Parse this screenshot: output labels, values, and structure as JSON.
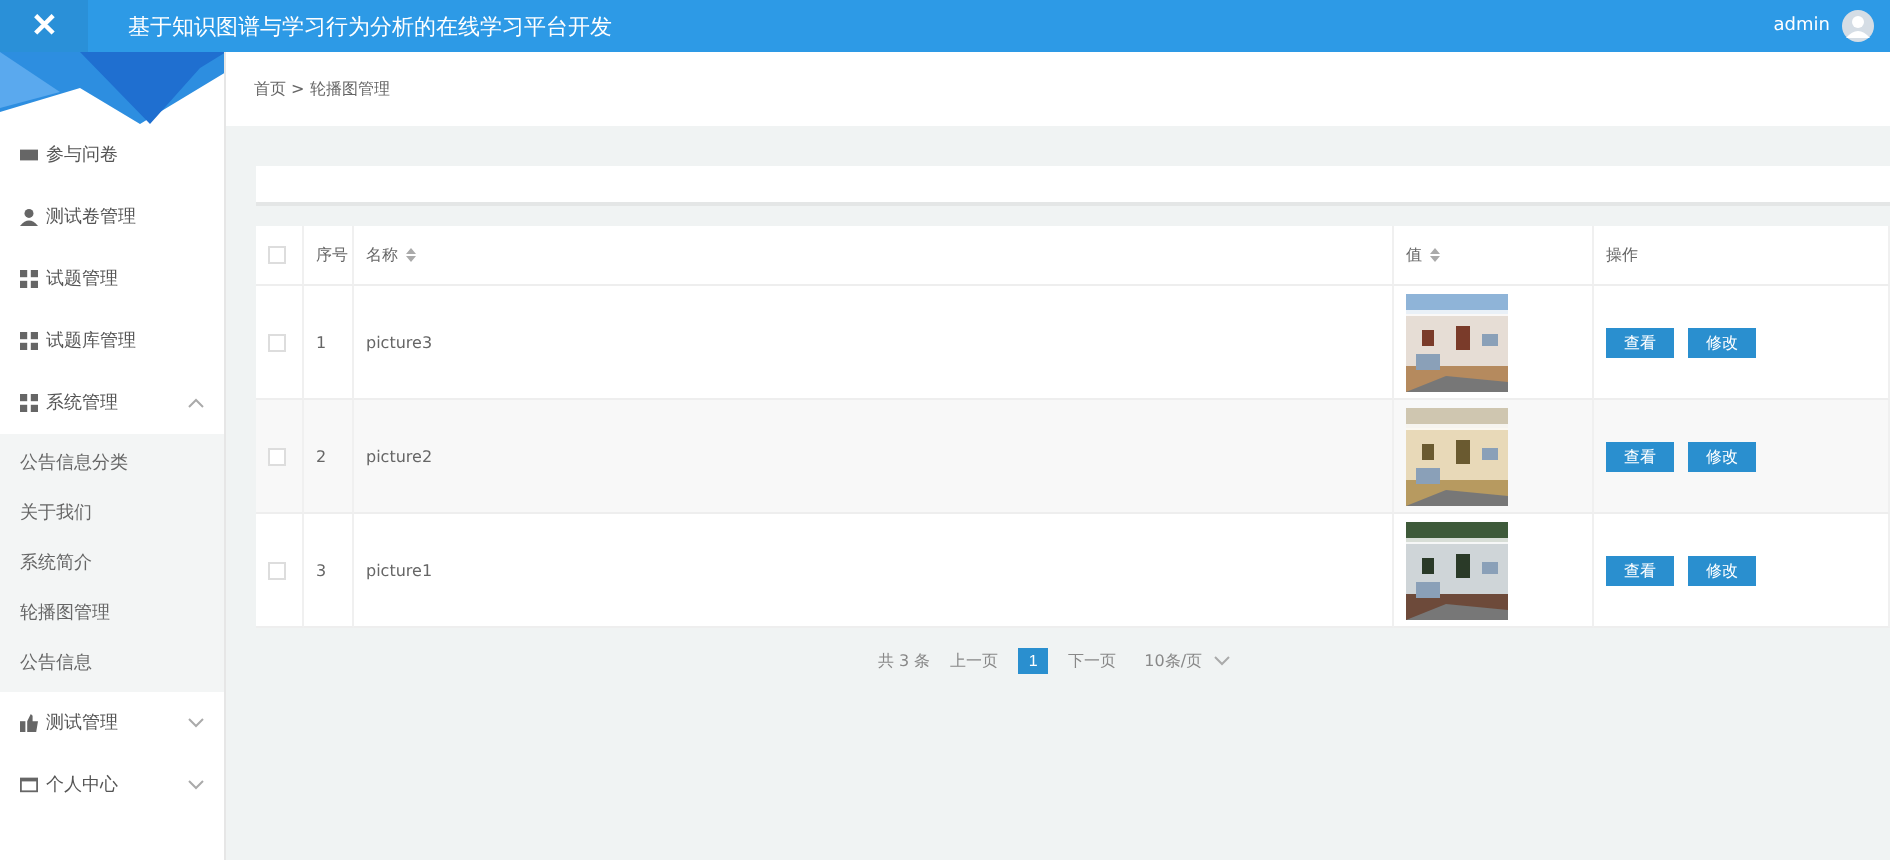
{
  "header": {
    "title": "基于知识图谱与学习行为分析的在线学习平台开发",
    "close_icon": "✕",
    "user": "admin"
  },
  "breadcrumb": "首页 > 轮播图管理",
  "sidebar": {
    "items": [
      {
        "label": "参与问卷"
      },
      {
        "label": "测试卷管理"
      },
      {
        "label": "试题管理"
      },
      {
        "label": "试题库管理"
      },
      {
        "label": "系统管理",
        "expanded": true,
        "children": [
          {
            "label": "公告信息分类"
          },
          {
            "label": "关于我们"
          },
          {
            "label": "系统简介"
          },
          {
            "label": "轮播图管理"
          },
          {
            "label": "公告信息"
          }
        ]
      },
      {
        "label": "测试管理",
        "expanded": false
      },
      {
        "label": "个人中心",
        "expanded": false
      }
    ]
  },
  "table": {
    "all_checked": false,
    "columns": [
      {
        "label": "序号",
        "sortable": false
      },
      {
        "label": "名称",
        "sortable": true
      },
      {
        "label": "值",
        "sortable": true
      },
      {
        "label": "操作",
        "sortable": false
      }
    ],
    "rows": [
      {
        "index": "1",
        "name": "picture3",
        "value": {
          "kind": "picture"
        },
        "checked": false,
        "actions": [
          "查看",
          "修改"
        ]
      },
      {
        "index": "2",
        "name": "picture2",
        "value": {
          "kind": "picture"
        },
        "checked": false,
        "actions": [
          "查看",
          "修改"
        ]
      },
      {
        "index": "3",
        "name": "picture1",
        "value": {
          "kind": "picture"
        },
        "checked": false,
        "actions": [
          "查看",
          "修改"
        ]
      }
    ]
  },
  "pagination": {
    "total": "共 3 条",
    "prev": "上一页",
    "pages": [
      {
        "label": "1",
        "selected": true
      }
    ],
    "next": "下一页",
    "page_size": "10条/页"
  }
}
